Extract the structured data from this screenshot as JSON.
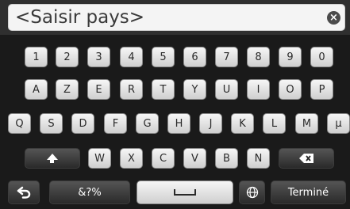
{
  "search": {
    "placeholder_text": "<Saisir pays>",
    "clear_icon": "x-circle-icon"
  },
  "keyboard": {
    "row1": [
      "1",
      "2",
      "3",
      "4",
      "5",
      "6",
      "7",
      "8",
      "9",
      "0"
    ],
    "row2": [
      "A",
      "Z",
      "E",
      "R",
      "T",
      "Y",
      "U",
      "I",
      "O",
      "P"
    ],
    "row3": [
      "Q",
      "S",
      "D",
      "F",
      "G",
      "H",
      "J",
      "K",
      "L",
      "M",
      "µ"
    ],
    "row4": [
      "W",
      "X",
      "C",
      "V",
      "B",
      "N"
    ],
    "symbols_label": "&?%",
    "done_label": "Terminé",
    "icons": {
      "shift": "shift-up-arrow-icon",
      "backspace": "backspace-icon",
      "back": "back-arrow-icon",
      "language": "globe-icon",
      "space": "space-bar-icon"
    }
  }
}
